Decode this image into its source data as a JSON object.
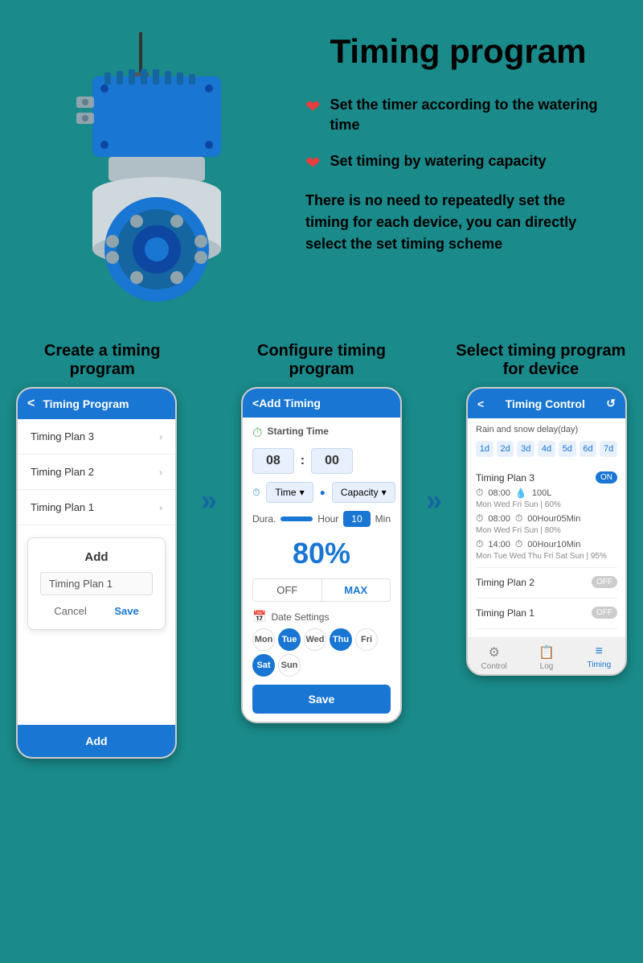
{
  "page": {
    "title": "Timing program",
    "background_color": "#1a8a8a"
  },
  "features": {
    "item1": "Set the timer according to the watering time",
    "item2": "Set timing by watering capacity",
    "description": "There is no need to repeatedly set the timing for each device, you can directly select the set timing scheme"
  },
  "steps": {
    "step1_title": "Create a timing program",
    "step2_title": "Configure timing program",
    "step3_title": "Select timing program for device"
  },
  "phone1": {
    "header": "Timing Program",
    "plans": [
      "Timing Plan 3",
      "Timing Plan 2",
      "Timing Plan 1"
    ],
    "modal_title": "Add",
    "modal_input": "Timing Plan 1",
    "btn_cancel": "Cancel",
    "btn_save": "Save",
    "footer_btn": "Add"
  },
  "phone2": {
    "header": "Add Timing",
    "starting_time_label": "Starting Time",
    "time_hour": "08",
    "time_minute": "00",
    "type_label": "Time",
    "capacity_label": "Capacity",
    "duration_label": "Dura.",
    "duration_unit1": "Hour",
    "duration_value": "10",
    "duration_unit2": "Min",
    "percent": "80%",
    "off_label": "OFF",
    "max_label": "MAX",
    "date_label": "Date Settings",
    "days": [
      "Mon",
      "Tue",
      "Wed",
      "Thu",
      "Fri",
      "Sat",
      "Sun"
    ],
    "active_days": [
      "Tue",
      "Thu",
      "Sat"
    ],
    "save_label": "Save"
  },
  "phone3": {
    "header": "Timing Control",
    "delay_label": "Rain and snow delay(day)",
    "day_tabs": [
      "1d",
      "2d",
      "3d",
      "4d",
      "5d",
      "6d",
      "7d"
    ],
    "plan3": {
      "name": "Timing Plan 3",
      "toggle": "ON",
      "entry1_time": "08:00",
      "entry1_capacity": "100L",
      "entry1_days": "Mon Wed Fri Sun | 60%",
      "entry2_time": "08:00",
      "entry2_duration": "00Hour05Min",
      "entry2_days": "Mon Wed Fri Sun | 80%",
      "entry3_time": "14:00",
      "entry3_duration": "00Hour10Min",
      "entry3_days": "Mon Tue Wed Thu Fri Sat Sun | 95%"
    },
    "plan2": {
      "name": "Timing Plan 2",
      "toggle": "OFF"
    },
    "plan1": {
      "name": "Timing Plan 1",
      "toggle": "OFF"
    },
    "footer_tabs": [
      {
        "label": "Control",
        "icon": "⚙"
      },
      {
        "label": "Log",
        "icon": "📋"
      },
      {
        "label": "Timing",
        "icon": "≡"
      }
    ],
    "active_tab": "Timing"
  }
}
